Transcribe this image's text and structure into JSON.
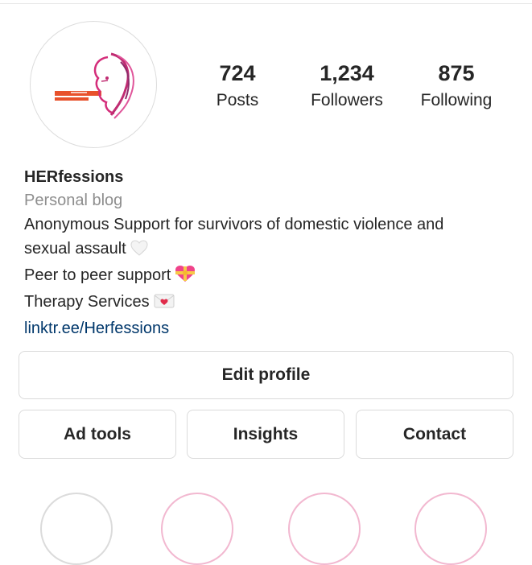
{
  "profile": {
    "username": "HERfessions",
    "category": "Personal blog",
    "bio_lines": [
      "Anonymous Support for survivors of domestic violence and",
      "sexual assault",
      "Peer to peer support",
      "Therapy Services"
    ],
    "link": "linktr.ee/Herfessions",
    "avatar_icon": "herfessions-logo-icon"
  },
  "stats": [
    {
      "value": "724",
      "label": "Posts"
    },
    {
      "value": "1,234",
      "label": "Followers"
    },
    {
      "value": "875",
      "label": "Following"
    }
  ],
  "buttons": {
    "edit_profile": "Edit profile",
    "ad_tools": "Ad tools",
    "insights": "Insights",
    "contact": "Contact"
  },
  "emoji_icons": [
    "white-heart-icon",
    "heart-with-ribbon-icon",
    "love-letter-icon"
  ],
  "colors": {
    "link": "#00376b",
    "muted": "#8e8e8e",
    "text": "#262626",
    "border": "#dbdbdb"
  }
}
